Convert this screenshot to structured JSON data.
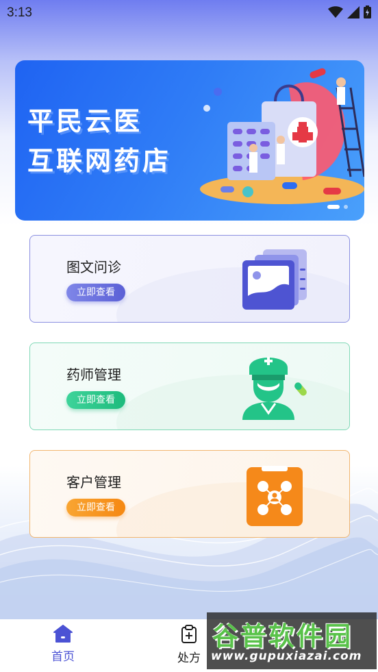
{
  "status_bar": {
    "time": "3:13"
  },
  "banner": {
    "line1": "平民云医",
    "line2": "互联网药店",
    "slides": 2,
    "active_slide": 1
  },
  "cards": [
    {
      "title": "图文问诊",
      "button": "立即查看",
      "icon": "photo-gallery-icon",
      "accent": "#5b60d6"
    },
    {
      "title": "药师管理",
      "button": "立即查看",
      "icon": "pharmacist-icon",
      "accent": "#1dbb7c"
    },
    {
      "title": "客户管理",
      "button": "立即查看",
      "icon": "customer-network-icon",
      "accent": "#f58812"
    }
  ],
  "bottom_nav": {
    "items": [
      {
        "label": "首页",
        "icon": "home-icon",
        "active": true
      },
      {
        "label": "处方",
        "icon": "prescription-clipboard-icon",
        "active": false
      }
    ],
    "active_color": "#4b52d4"
  },
  "watermark": {
    "top": "谷普软件园",
    "bottom": "www.gupuxiazai.com"
  }
}
